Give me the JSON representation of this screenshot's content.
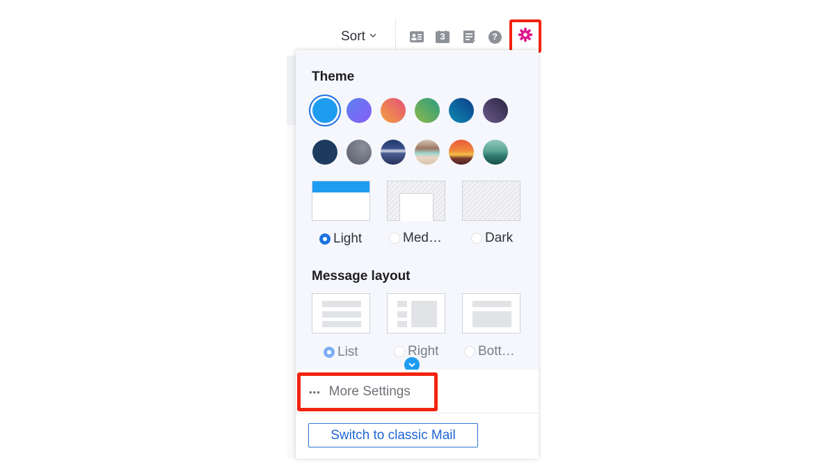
{
  "toolbar": {
    "sort_label": "Sort",
    "sort_chevron": "⌄",
    "icons": [
      "contacts-card-icon",
      "calendar-icon",
      "notepad-icon",
      "help-icon",
      "settings-gear-icon"
    ],
    "calendar_day": "3",
    "help_glyph": "?"
  },
  "colors": {
    "accent": "#1d72e0",
    "gear": "#e0198c",
    "highlight_box": "#f2240f",
    "link": "#1d64d6"
  },
  "theme": {
    "heading": "Theme",
    "swatches": [
      {
        "name": "blue",
        "selected": true
      },
      {
        "name": "purple",
        "selected": false
      },
      {
        "name": "orange-pink",
        "selected": false
      },
      {
        "name": "green",
        "selected": false
      },
      {
        "name": "teal-navy",
        "selected": false
      },
      {
        "name": "dark-purple",
        "selected": false
      },
      {
        "name": "navy",
        "selected": false
      },
      {
        "name": "gray",
        "selected": false
      },
      {
        "name": "mountain-snow",
        "selected": false
      },
      {
        "name": "desert-camper",
        "selected": false
      },
      {
        "name": "sunset",
        "selected": false
      },
      {
        "name": "teal-mountains",
        "selected": false
      }
    ],
    "brightness": {
      "options": [
        {
          "label": "Light",
          "selected": true
        },
        {
          "label": "Med…",
          "selected": false
        },
        {
          "label": "Dark",
          "selected": false
        }
      ]
    }
  },
  "message_layout": {
    "heading": "Message layout",
    "options": [
      {
        "label": "List",
        "selected": true
      },
      {
        "label": "Right",
        "selected": false
      },
      {
        "label": "Bott…",
        "selected": false
      }
    ]
  },
  "footer": {
    "more_settings_icon": "•••",
    "more_settings_label": "More Settings",
    "switch_classic_label": "Switch to classic Mail"
  }
}
